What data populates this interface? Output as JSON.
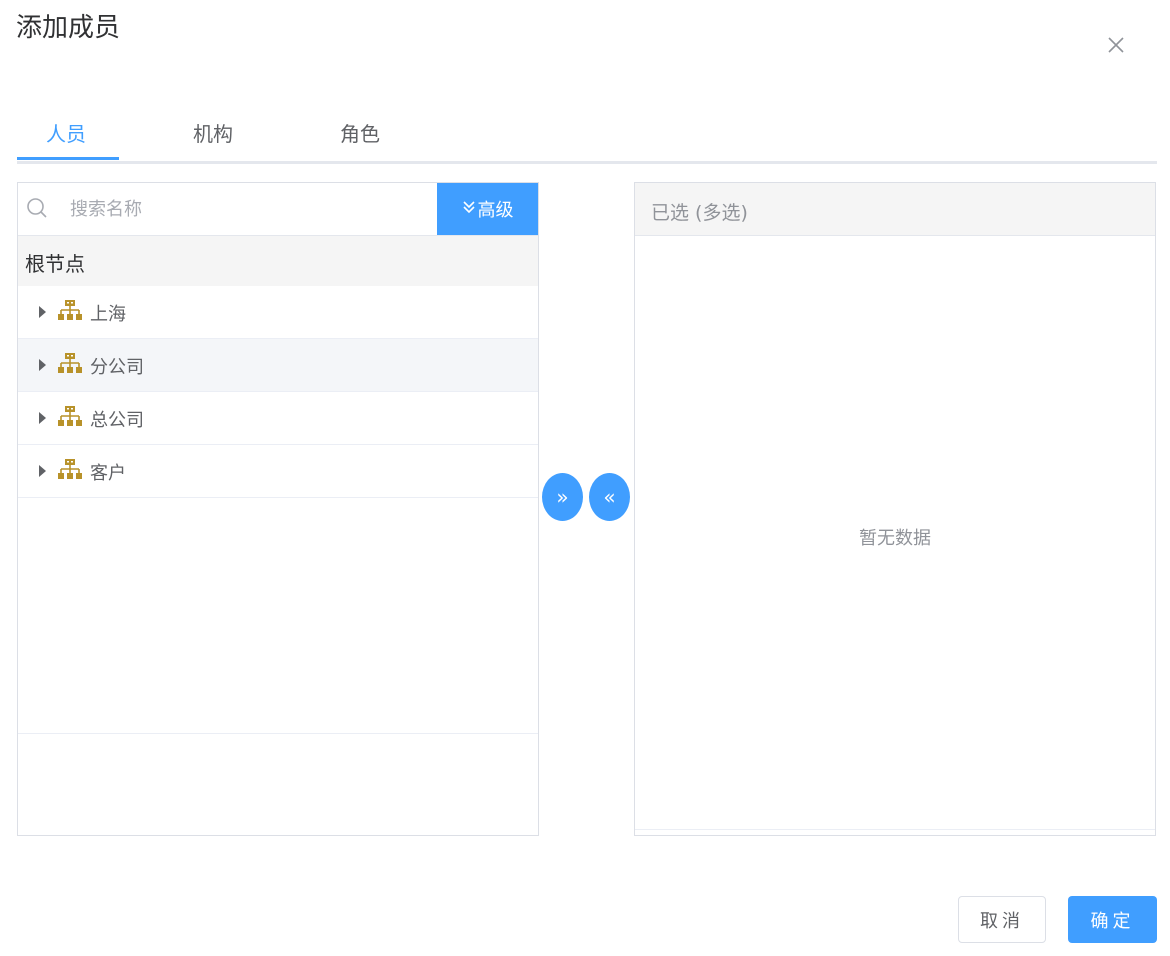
{
  "dialog": {
    "title": "添加成员"
  },
  "tabs": [
    {
      "label": "人员",
      "active": true
    },
    {
      "label": "机构",
      "active": false
    },
    {
      "label": "角色",
      "active": false
    }
  ],
  "left": {
    "search_placeholder": "搜索名称",
    "advanced_label": "高级",
    "advanced_icon": "double-chevron-down-icon",
    "root_label": "根节点",
    "tree": [
      {
        "label": "上海",
        "icon": "org-chart-icon"
      },
      {
        "label": "分公司",
        "icon": "org-chart-icon"
      },
      {
        "label": "总公司",
        "icon": "org-chart-icon"
      },
      {
        "label": "客户",
        "icon": "org-chart-icon"
      }
    ]
  },
  "transfer": {
    "add_glyph": "»",
    "remove_glyph": "«"
  },
  "right": {
    "header": "已选 (多选)",
    "empty_text": "暂无数据"
  },
  "footer": {
    "cancel_label": "取消",
    "ok_label": "确定"
  },
  "colors": {
    "primary": "#409eff",
    "org_icon": "#b8922a",
    "header_bg": "#f5f5f5"
  }
}
